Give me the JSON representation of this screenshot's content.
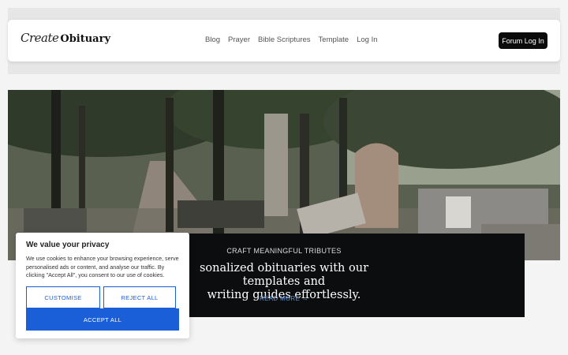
{
  "header": {
    "logo_script": "Create",
    "logo_bold": "Obituary",
    "nav": [
      "Blog",
      "Prayer",
      "Bible Scriptures",
      "Template",
      "Log In"
    ],
    "forum_button": "Forum Log In"
  },
  "hero": {
    "kicker": "CRAFT MEANINGFUL TRIBUTES",
    "title_line1": "sonalized obituaries with our templates and",
    "title_line2": "writing guides effortlessly.",
    "link": "READ MORE →"
  },
  "cookie": {
    "title": "We value your privacy",
    "body": "We use cookies to enhance your browsing experience, serve personalised ads or content, and analyse our traffic. By clicking \"Accept All\", you consent to our use of cookies.",
    "customise": "CUSTOMISE",
    "reject": "REJECT ALL",
    "accept": "ACCEPT ALL"
  },
  "colors": {
    "accent": "#1a5fd8",
    "dark": "#0b0b0b"
  }
}
